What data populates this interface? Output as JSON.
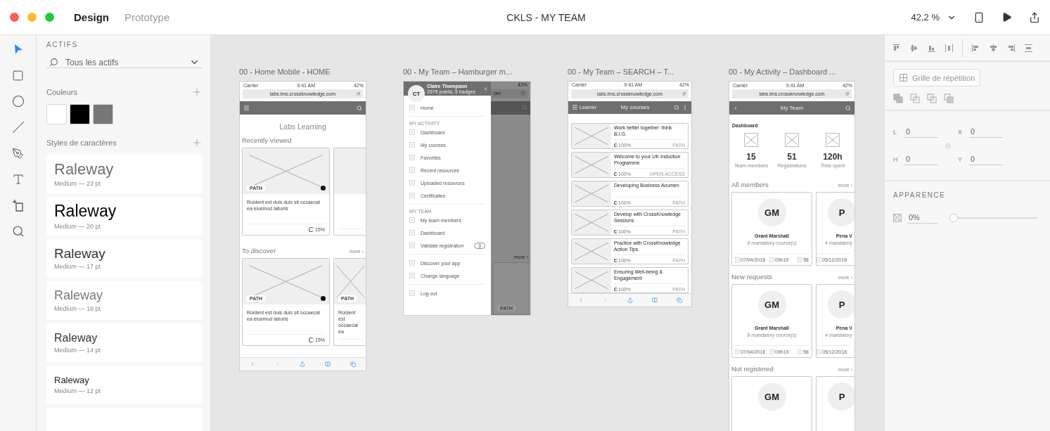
{
  "window": {
    "title": "CKLS - MY TEAM",
    "zoom": "42,2 %"
  },
  "mode_tabs": [
    {
      "label": "Design",
      "selected": true
    },
    {
      "label": "Prototype",
      "selected": false
    }
  ],
  "tools": [
    {
      "kind": "select",
      "selected": true
    },
    {
      "kind": "rectangle",
      "selected": false
    },
    {
      "kind": "ellipse",
      "selected": false
    },
    {
      "kind": "line",
      "selected": false
    },
    {
      "kind": "pen",
      "selected": false
    },
    {
      "kind": "text",
      "selected": false
    },
    {
      "kind": "artboard",
      "selected": false
    },
    {
      "kind": "zoom",
      "selected": false
    }
  ],
  "assets": {
    "heading": "ACTIFS",
    "filter": "Tous les actifs",
    "colors_label": "Couleurs",
    "swatches": [
      {
        "color": "#ffffff"
      },
      {
        "color": "#000000"
      },
      {
        "color": "#777777"
      }
    ],
    "styles_label": "Styles de caractères",
    "char_styles": [
      {
        "sample": "Raleway",
        "spec": "Medium — 23 pt",
        "color": "#707070"
      },
      {
        "sample": "Raleway",
        "spec": "Medium — 20 pt",
        "color": "#000000"
      },
      {
        "sample": "Raleway",
        "spec": "Medium — 17 pt",
        "color": "#333333"
      },
      {
        "sample": "Raleway",
        "spec": "Medium — 16 pt",
        "color": "#7a7a7a"
      },
      {
        "sample": "Raleway",
        "spec": "Medium — 14 pt",
        "color": "#333333"
      },
      {
        "sample": "Raleway",
        "spec": "Medium — 12 pt",
        "color": "#222222"
      }
    ]
  },
  "artboards": [
    {
      "kind": "home",
      "title": "00 - Home Mobile - HOME",
      "status": {
        "carrier": "Carrier",
        "time": "9:41 AM",
        "battery": "42%"
      },
      "url": "labs.lms.crossknowledge.com",
      "heading": "Labs Learning",
      "sections": [
        {
          "title": "Recently Viewed",
          "cards": [
            {
              "badge": "PATH",
              "text": "Roident est duis duis sit occaecat ea eiusmod laboris",
              "progress": "15%",
              "cut": false
            },
            {
              "cut": true
            }
          ]
        },
        {
          "title": "To discover",
          "more": "more ›",
          "cards": [
            {
              "badge": "PATH",
              "text": "Roident est duis duis sit occaecat ea eiusmod laboris",
              "progress": "15%",
              "cut": false
            },
            {
              "badge": "PATH",
              "text": "Roident est occaecat ea",
              "cut": true
            }
          ]
        }
      ]
    },
    {
      "kind": "menu",
      "title": "00 - My Team  – Hamburger m...",
      "user": {
        "initials": "CT",
        "name": "Claire Thompson",
        "subtitle": "2575 points, 5 badges"
      },
      "groups": [
        {
          "items": [
            {
              "label": "Home"
            }
          ]
        },
        {
          "label": "MY ACTIVITY",
          "items": [
            {
              "label": "Dashboard"
            },
            {
              "label": "My courses"
            },
            {
              "label": "Favorites"
            },
            {
              "label": "Recent resources"
            },
            {
              "label": "Uploaded resources"
            },
            {
              "label": "Certificates"
            }
          ]
        },
        {
          "label": "MY TEAM",
          "items": [
            {
              "label": "My team members"
            },
            {
              "label": "Dashboard"
            },
            {
              "label": "Validate registration",
              "badge": "3"
            }
          ]
        },
        {
          "items": [
            {
              "label": "Discover your app"
            },
            {
              "label": "Change language"
            }
          ]
        },
        {
          "items": [
            {
              "label": "Log out"
            }
          ]
        }
      ],
      "backdrop": {
        "battery": "42%",
        "url_fragment": "om",
        "more": "more ›",
        "badge": "PATH"
      }
    },
    {
      "kind": "courses",
      "title": "00 - My Team  – SEARCH  – T...",
      "status": {
        "carrier": "Carrier",
        "time": "9:41 AM",
        "battery": "42%"
      },
      "url": "labs.lms.crossknowledge.com",
      "role": "Learner",
      "heading": "My courses",
      "courses": [
        {
          "title": "Work better together: think B.I.G.",
          "progress": "100%",
          "type": "PATH"
        },
        {
          "title": "Welcome to your UK Induction Programme",
          "progress": "100%",
          "type": "OPEN ACCESS"
        },
        {
          "title": "Developing Business Acumen",
          "progress": "100%",
          "type": "PATH"
        },
        {
          "title": "Develop with CrossKnowledge Sessions",
          "progress": "100%",
          "type": "PATH"
        },
        {
          "title": "Practice with CrossKnowledge Action Tips",
          "progress": "100%",
          "type": "PATH"
        },
        {
          "title": "Ensuring Well-being & Engagement",
          "progress": "100%",
          "type": "PATH"
        }
      ]
    },
    {
      "kind": "dashboard",
      "title": "00 - My Activity  –  Dashboard ...",
      "status": {
        "carrier": "Carrier",
        "time": "9:41 AM",
        "battery": "42%"
      },
      "url": "labs.lms.crossknowledge.com",
      "heading": "My Team",
      "subheading": "Dashboard",
      "stats": [
        {
          "value": "15",
          "label": "Team members"
        },
        {
          "value": "51",
          "label": "Registrations"
        },
        {
          "value": "120h",
          "label": "Time spent"
        }
      ],
      "sections": [
        {
          "title": "All members",
          "more": "more ›",
          "members": [
            {
              "initials": "GM",
              "name": "Grant Marshall",
              "sub": "8 mandatory course(s)",
              "date": "07/04/2018",
              "time": "09h19",
              "count": "58",
              "cut": false
            },
            {
              "initials": "P",
              "name": "Pena V",
              "sub": "4 mandatory",
              "date": "05/12/2018",
              "cut": true
            }
          ]
        },
        {
          "title": "New requests",
          "more": "more ›",
          "members": [
            {
              "initials": "GM",
              "name": "Grant Marshall",
              "sub": "8 mandatory course(s)",
              "date": "07/04/2018",
              "time": "09h19",
              "count": "58",
              "cut": false
            },
            {
              "initials": "P",
              "name": "Pena V",
              "sub": "4 mandatory",
              "date": "05/12/2018",
              "cut": true
            }
          ]
        },
        {
          "title": "Not registered",
          "more": "more ›",
          "members": [
            {
              "initials": "GM",
              "cut": false
            },
            {
              "initials": "P",
              "cut": true
            }
          ]
        }
      ]
    }
  ],
  "properties": {
    "repeat_grid": "Grille de répétition",
    "fields": [
      {
        "label": "L",
        "value": "0"
      },
      {
        "label": "X",
        "value": "0"
      },
      {
        "label": "H",
        "value": "0"
      },
      {
        "label": "Y",
        "value": "0"
      }
    ],
    "appearance": "APPARENCE",
    "opacity": {
      "value": "0%",
      "level": 0
    }
  }
}
